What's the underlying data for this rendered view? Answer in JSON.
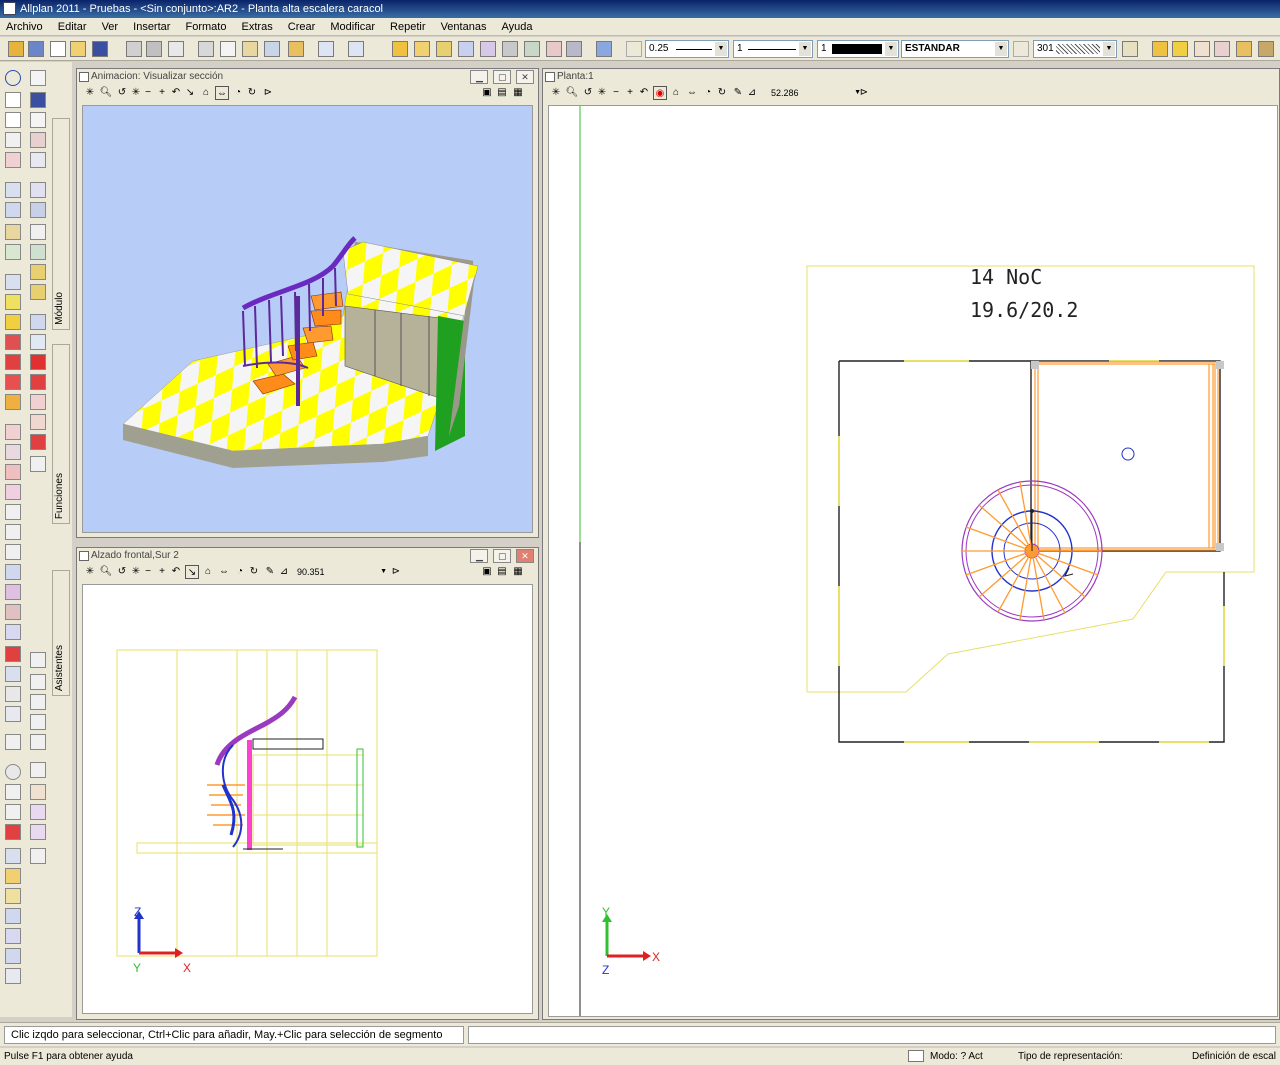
{
  "window": {
    "title": "Allplan 2011 - Pruebas - <Sin conjunto>:AR2 - Planta alta escalera caracol"
  },
  "menu": [
    "Archivo",
    "Editar",
    "Ver",
    "Insertar",
    "Formato",
    "Extras",
    "Crear",
    "Modificar",
    "Repetir",
    "Ventanas",
    "Ayuda"
  ],
  "toolbar": {
    "pen_value": "0.25",
    "line_value": "1",
    "color_value": "1",
    "layer_value": "ESTANDAR",
    "pattern_value": "301"
  },
  "side_tabs": {
    "modulo": "Módulo",
    "funciones": "Funciones",
    "asistentes": "Asistentes"
  },
  "viewports": {
    "animation": {
      "title": "Animacion: Visualizar sección"
    },
    "elevation": {
      "title": "Alzado frontal,Sur 2",
      "scale": "90.351"
    },
    "plan": {
      "title": "Planta:1",
      "scale": "52.286"
    }
  },
  "drawing": {
    "room_label": "14 NoC",
    "room_dims": "19.6/20.2",
    "axis_x": "X",
    "axis_y": "Y",
    "axis_z": "Z"
  },
  "colors": {
    "yellow_line": "#e8e06a",
    "plan_black": "#222222",
    "stair_orange": "#ff8c1a",
    "stair_purple": "#8a2be2",
    "stair_blue": "#2233cc",
    "anim_bg": "#b8ccf8"
  },
  "status": {
    "prompt": "Clic izqdo para seleccionar, Ctrl+Clic para añadir, May.+Clic para selección de segmento",
    "help": "Pulse F1 para obtener ayuda",
    "modo": "Modo: ? Act",
    "repr": "Tipo de representación:",
    "escala": "Definición de escal"
  }
}
